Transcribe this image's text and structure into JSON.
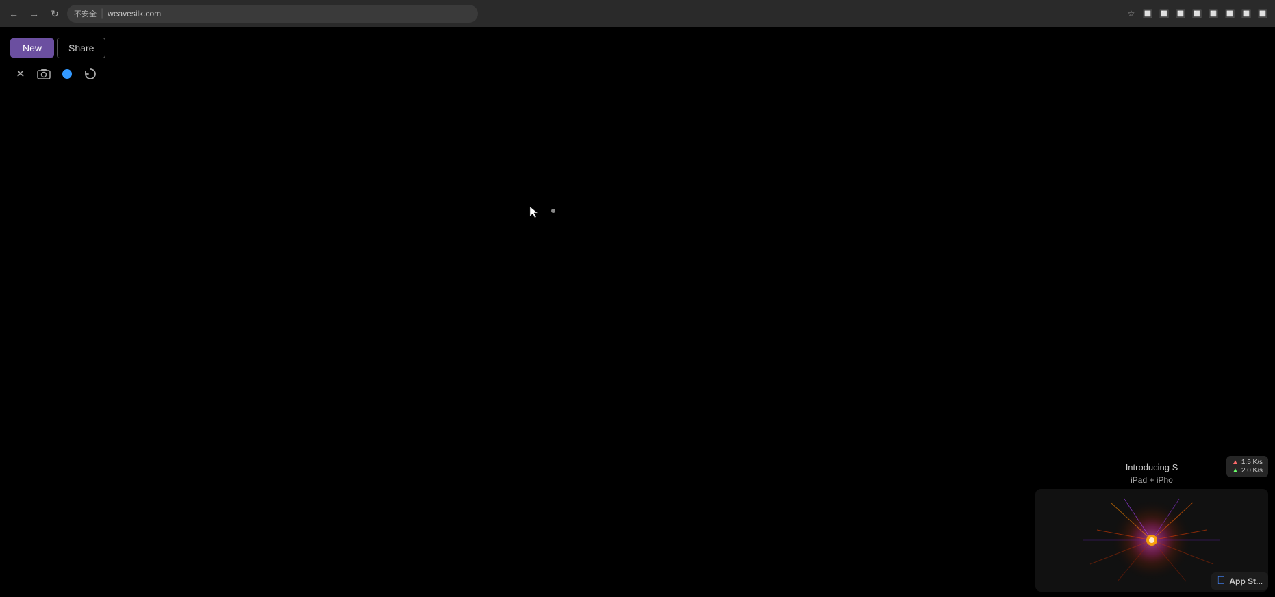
{
  "browser": {
    "title": "weavesilk.com",
    "security_label": "不安全",
    "url": "weavesilk.com",
    "nav": {
      "back_label": "←",
      "forward_label": "→",
      "refresh_label": "↻"
    }
  },
  "toolbar": {
    "new_label": "New",
    "share_label": "Share",
    "tools": {
      "move_label": "✕",
      "camera_label": "📷",
      "circle_color": "#3399ff",
      "refresh_label": "↺"
    }
  },
  "canvas": {
    "background": "#000000"
  },
  "promo": {
    "introducing_text": "Introducing S",
    "sub_text": "iPad + iPho"
  },
  "network": {
    "upload": "1.5 K/s",
    "download": "2.0 K/s"
  },
  "app_store": {
    "label": "App St..."
  }
}
